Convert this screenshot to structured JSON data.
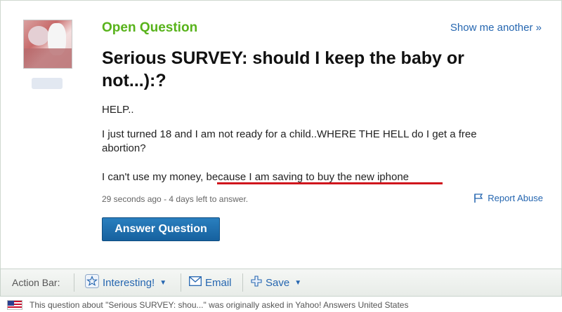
{
  "question": {
    "status_label": "Open Question",
    "show_another": "Show me another »",
    "title": "Serious SURVEY: should I keep the baby or not...):?",
    "body": {
      "p1": "HELP..",
      "p2": "I just turned 18 and I am not ready for a child..WHERE THE HELL do I get a free abortion?",
      "p3_lead": "I can't use my money, ",
      "p3_underlined": "because I am saving to buy the new iphone"
    },
    "meta": "29 seconds ago - 4 days left to answer.",
    "report_label": "Report Abuse",
    "answer_button": "Answer Question"
  },
  "action_bar": {
    "label": "Action Bar:",
    "interesting": "Interesting!",
    "email": "Email",
    "save": "Save"
  },
  "footer": {
    "text": "This question about \"Serious SURVEY: shou...\" was originally asked in Yahoo! Answers United States"
  },
  "colors": {
    "open_question": "#58b31b",
    "link": "#2566b0",
    "underline_mark": "#d0161d",
    "button": "#16619f"
  },
  "icons": [
    "avatar-image",
    "flag-icon",
    "star-icon",
    "envelope-icon",
    "plus-icon",
    "us-flag-icon"
  ]
}
